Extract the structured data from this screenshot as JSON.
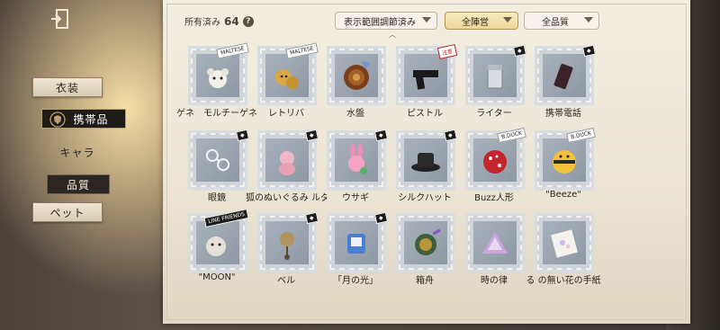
{
  "header": {
    "owned_label": "所有済み",
    "owned_count": "64",
    "help": "?",
    "filters": [
      {
        "label": "表示範囲調節済み"
      },
      {
        "label": "全陣営"
      },
      {
        "label": "全品質"
      }
    ]
  },
  "sidebar": {
    "items": [
      {
        "label": "衣装"
      },
      {
        "label": "携帯品"
      },
      {
        "label": "キャラ"
      },
      {
        "label": "品質"
      },
      {
        "label": "ペット"
      }
    ]
  },
  "items": [
    {
      "label": "ゲネ　モルチーゲネ",
      "icon": "maltese-dog-charm-icon",
      "tag": "MALTESE"
    },
    {
      "label": "レトリバ",
      "icon": "retriever-dog-charm-icon",
      "tag": "MALTESE"
    },
    {
      "label": "水盤",
      "icon": "water-basin-icon",
      "tag": ""
    },
    {
      "label": "ピストル",
      "icon": "pistol-icon",
      "tag": ""
    },
    {
      "label": "ライター",
      "icon": "lighter-icon",
      "tag": ""
    },
    {
      "label": "携帯電話",
      "icon": "mobile-phone-icon",
      "tag": ""
    },
    {
      "label": "眼鏡",
      "icon": "glasses-icon",
      "tag": ""
    },
    {
      "label": "狐のぬいぐるみ ルダー",
      "icon": "fox-plush-icon",
      "tag": ""
    },
    {
      "label": "ウサギ",
      "icon": "rabbit-charm-icon",
      "tag": ""
    },
    {
      "label": "シルクハット",
      "icon": "silk-hat-icon",
      "tag": ""
    },
    {
      "label": "Buzz人形",
      "icon": "buzz-doll-icon",
      "tag": "B.DUCK"
    },
    {
      "label": "\"Beeze\"",
      "icon": "beeze-bee-icon",
      "tag": "B.DUCK"
    },
    {
      "label": "\"MOON\"",
      "icon": "moon-bear-icon",
      "tag": "LINE FRIENDS"
    },
    {
      "label": "ベル",
      "icon": "bell-icon",
      "tag": ""
    },
    {
      "label": "「月の光」",
      "icon": "moonlight-bag-icon",
      "tag": ""
    },
    {
      "label": "箱舟",
      "icon": "ark-icon",
      "tag": ""
    },
    {
      "label": "時の律",
      "icon": "rhythm-of-time-icon",
      "tag": ""
    },
    {
      "label": "る の無い花の手紙",
      "icon": "flower-letter-icon",
      "tag": ""
    }
  ],
  "colors": {
    "accent_gold": "#eed79a",
    "paper": "#f3eee2",
    "stamp": "#8e98a3"
  }
}
